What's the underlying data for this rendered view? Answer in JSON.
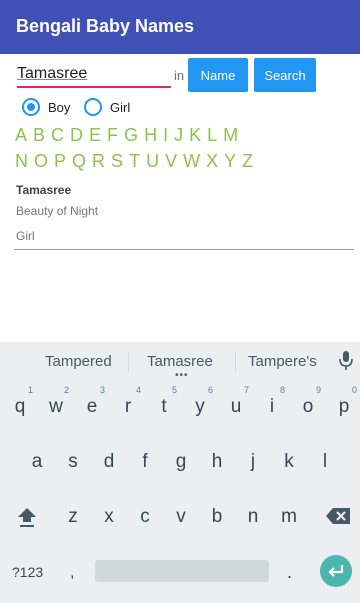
{
  "app": {
    "title": "Bengali Baby Names"
  },
  "search": {
    "value": "Tamasree",
    "in_label": "in",
    "name_button": "Name",
    "search_button": "Search"
  },
  "gender": {
    "options": [
      "Boy",
      "Girl"
    ],
    "selected": "Boy"
  },
  "alphabet": {
    "row1": [
      "A",
      "B",
      "C",
      "D",
      "E",
      "F",
      "G",
      "H",
      "I",
      "J",
      "K",
      "L",
      "M"
    ],
    "row2": [
      "N",
      "O",
      "P",
      "Q",
      "R",
      "S",
      "T",
      "U",
      "V",
      "W",
      "X",
      "Y",
      "Z"
    ]
  },
  "result": {
    "name": "Tamasree",
    "meaning": "Beauty of Night",
    "gender": "Girl"
  },
  "keyboard": {
    "suggestions": [
      "Tampered",
      "Tamasree",
      "Tampere's"
    ],
    "row1": [
      "q",
      "w",
      "e",
      "r",
      "t",
      "y",
      "u",
      "i",
      "o",
      "p"
    ],
    "row1_numbers": [
      "1",
      "2",
      "3",
      "4",
      "5",
      "6",
      "7",
      "8",
      "9",
      "0"
    ],
    "row2": [
      "a",
      "s",
      "d",
      "f",
      "g",
      "h",
      "j",
      "k",
      "l"
    ],
    "row3": [
      "z",
      "x",
      "c",
      "v",
      "b",
      "n",
      "m"
    ],
    "symbols_label": "?123",
    "comma": ",",
    "period": "."
  },
  "colors": {
    "appbar": "#3f51b5",
    "accent": "#e91e63",
    "button": "#2196f3",
    "letters": "#8bc34a",
    "enter": "#4db6ac"
  }
}
